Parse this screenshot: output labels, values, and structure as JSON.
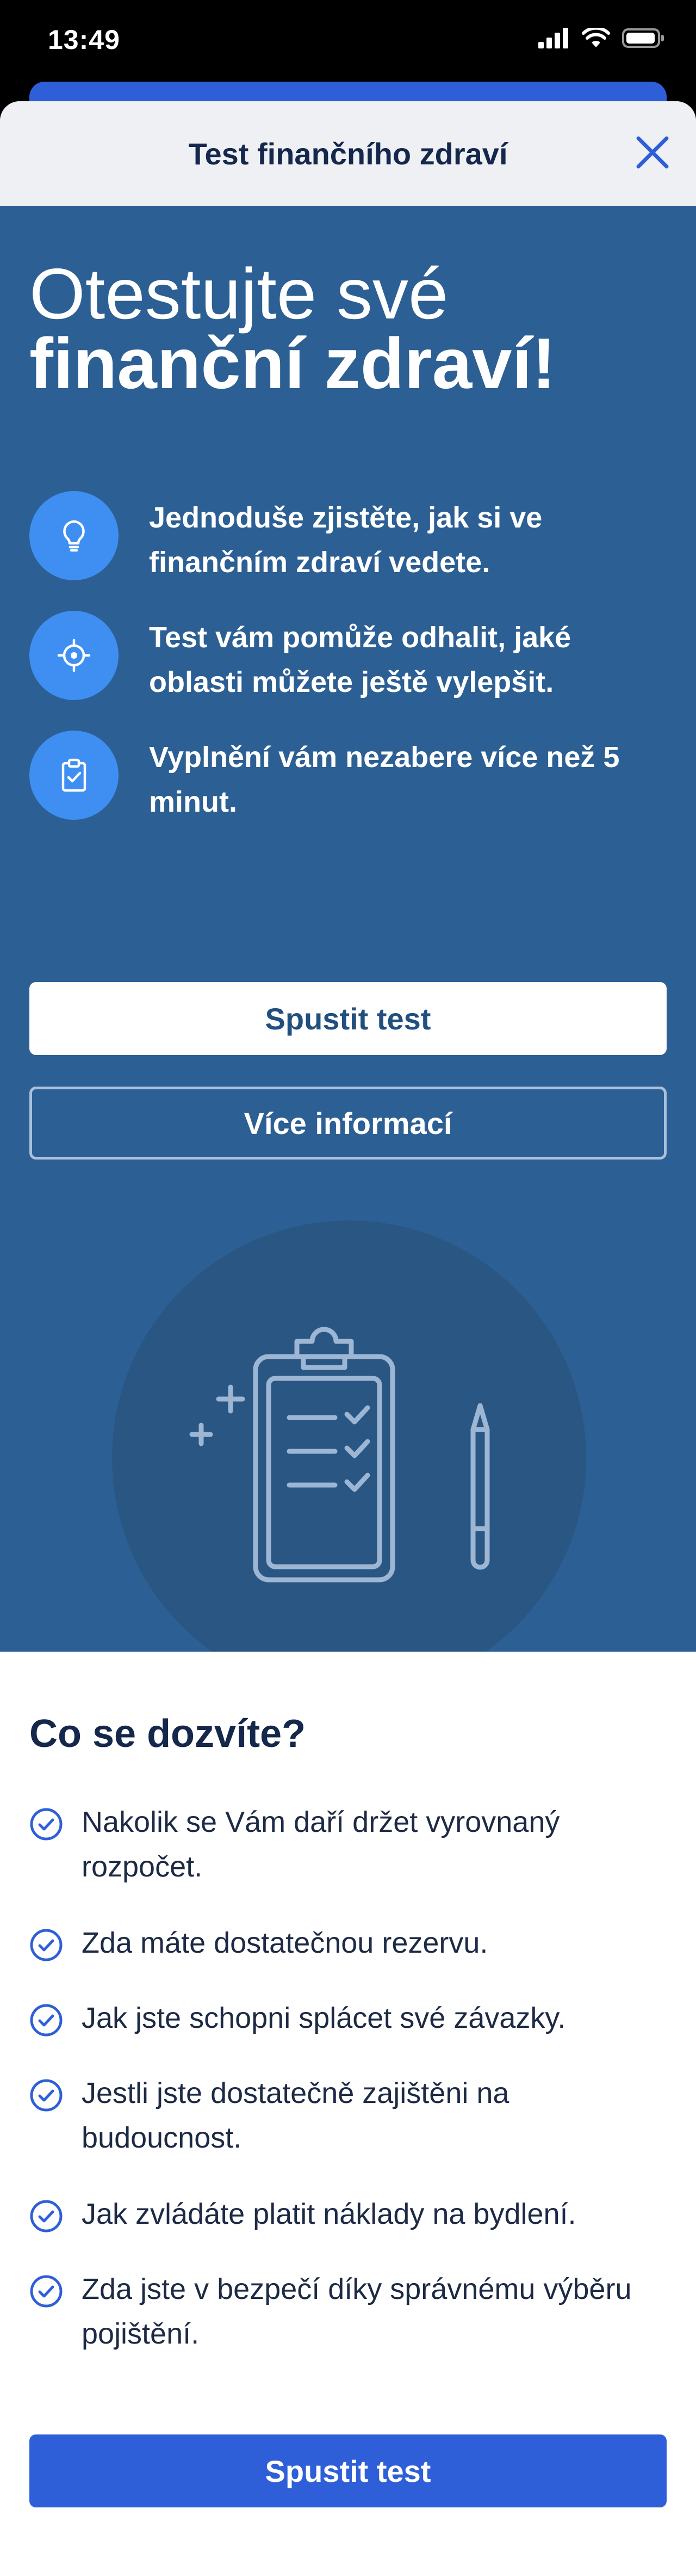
{
  "status_bar": {
    "time": "13:49"
  },
  "sheet": {
    "title": "Test finančního zdraví"
  },
  "hero": {
    "heading_line1": "Otestujte své",
    "heading_line2": "finanční zdraví!",
    "features": [
      {
        "icon": "lightbulb-icon",
        "text": "Jednoduše zjistěte, jak si ve finančním zdraví vedete."
      },
      {
        "icon": "target-icon",
        "text": "Test vám pomůže odhalit, jaké oblasti můžete ještě vylepšit."
      },
      {
        "icon": "clipboard-check-icon",
        "text": "Vyplnění vám nezabere více než 5 minut."
      }
    ],
    "start_button": "Spustit test",
    "more_info_button": "Více informací"
  },
  "info": {
    "heading": "Co se dozvíte?",
    "items": [
      "Nakolik se Vám daří držet vyrovnaný rozpočet.",
      "Zda máte dostatečnou rezervu.",
      "Jak jste schopni splácet své závazky.",
      "Jestli jste dostatečně zajištěni na budoucnost.",
      "Jak zvládáte platit náklady na bydlení.",
      "Zda jste v bezpečí díky správnému výběru pojištění."
    ],
    "start_button": "Spustit test"
  },
  "colors": {
    "hero_bg": "#2c5f93",
    "accent_blue": "#2f5fd8",
    "icon_circle": "#3f8ff3",
    "heading_dark": "#15284b"
  }
}
